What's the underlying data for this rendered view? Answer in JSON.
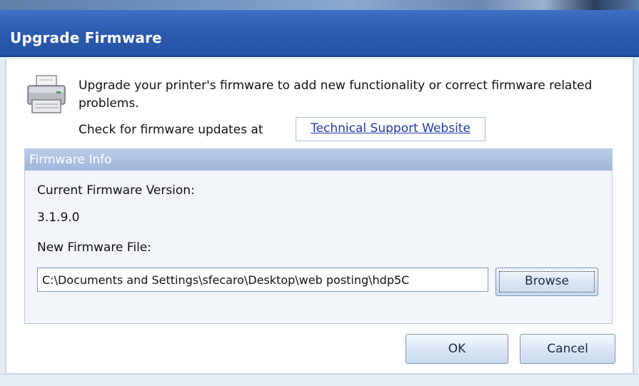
{
  "window": {
    "title": "Upgrade Firmware"
  },
  "intro": {
    "description": "Upgrade your printer's firmware to add new functionality or correct firmware related problems.",
    "check_label": "Check for firmware updates at",
    "support_link": "Technical Support Website"
  },
  "firmware_info": {
    "header": "Firmware Info",
    "current_label": "Current Firmware Version:",
    "current_value": "3.1.9.0",
    "new_file_label": "New Firmware File:",
    "new_file_value": "C:\\Documents and Settings\\sfecaro\\Desktop\\web posting\\hdp5C",
    "browse_label": "Browse"
  },
  "buttons": {
    "ok": "OK",
    "cancel": "Cancel"
  },
  "icons": {
    "printer": "printer-icon"
  },
  "colors": {
    "title_bar": "#2d5bb0",
    "group_header": "#aac0e2",
    "link": "#1c3aa6"
  }
}
